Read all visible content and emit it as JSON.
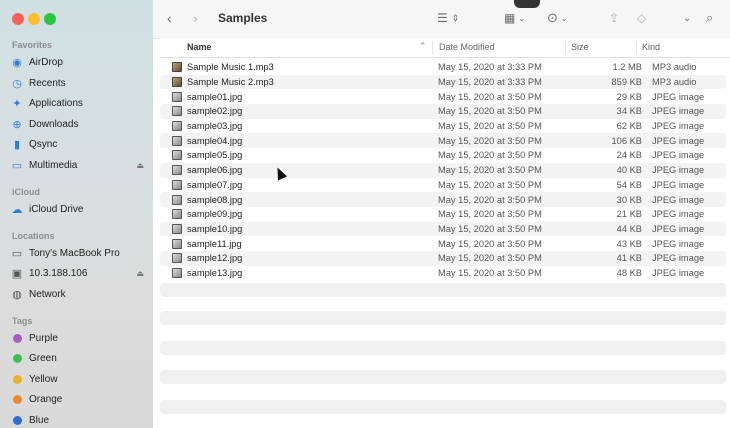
{
  "window": {
    "title": "Samples"
  },
  "sidebar": {
    "favorites_label": "Favorites",
    "favorites": [
      {
        "label": "AirDrop",
        "icon": "airdrop-icon"
      },
      {
        "label": "Recents",
        "icon": "clock-icon"
      },
      {
        "label": "Applications",
        "icon": "applications-icon"
      },
      {
        "label": "Downloads",
        "icon": "download-icon"
      },
      {
        "label": "Qsync",
        "icon": "document-icon"
      },
      {
        "label": "Multimedia",
        "icon": "folder-icon"
      }
    ],
    "icloud_label": "iCloud",
    "icloud": [
      {
        "label": "iCloud Drive",
        "icon": "cloud-icon"
      }
    ],
    "locations_label": "Locations",
    "locations": [
      {
        "label": "Tony's MacBook Pro",
        "icon": "laptop-icon"
      },
      {
        "label": "10.3.188.106",
        "icon": "monitor-icon"
      },
      {
        "label": "Network",
        "icon": "globe-icon"
      }
    ],
    "tags_label": "Tags",
    "tags": [
      {
        "label": "Purple",
        "color": "#a55ec9"
      },
      {
        "label": "Green",
        "color": "#3fbf4f"
      },
      {
        "label": "Yellow",
        "color": "#e6b422"
      },
      {
        "label": "Orange",
        "color": "#f0892c"
      },
      {
        "label": "Blue",
        "color": "#2a6dd8"
      }
    ]
  },
  "table": {
    "headers": {
      "name": "Name",
      "date": "Date Modified",
      "size": "Size",
      "kind": "Kind"
    },
    "rows": [
      {
        "name": "Sample Music 1.mp3",
        "date": "May 15, 2020 at 3:33 PM",
        "size": "1.2 MB",
        "kind": "MP3 audio",
        "type": "audio"
      },
      {
        "name": "Sample Music 2.mp3",
        "date": "May 15, 2020 at 3:33 PM",
        "size": "859 KB",
        "kind": "MP3 audio",
        "type": "audio"
      },
      {
        "name": "sample01.jpg",
        "date": "May 15, 2020 at 3:50 PM",
        "size": "29 KB",
        "kind": "JPEG image",
        "type": "image"
      },
      {
        "name": "sample02.jpg",
        "date": "May 15, 2020 at 3:50 PM",
        "size": "34 KB",
        "kind": "JPEG image",
        "type": "image"
      },
      {
        "name": "sample03.jpg",
        "date": "May 15, 2020 at 3:50 PM",
        "size": "62 KB",
        "kind": "JPEG image",
        "type": "image"
      },
      {
        "name": "sample04.jpg",
        "date": "May 15, 2020 at 3:50 PM",
        "size": "106 KB",
        "kind": "JPEG image",
        "type": "image"
      },
      {
        "name": "sample05.jpg",
        "date": "May 15, 2020 at 3:50 PM",
        "size": "24 KB",
        "kind": "JPEG image",
        "type": "image"
      },
      {
        "name": "sample06.jpg",
        "date": "May 15, 2020 at 3:50 PM",
        "size": "40 KB",
        "kind": "JPEG image",
        "type": "image"
      },
      {
        "name": "sample07.jpg",
        "date": "May 15, 2020 at 3:50 PM",
        "size": "54 KB",
        "kind": "JPEG image",
        "type": "image"
      },
      {
        "name": "sample08.jpg",
        "date": "May 15, 2020 at 3:50 PM",
        "size": "30 KB",
        "kind": "JPEG image",
        "type": "image"
      },
      {
        "name": "sample09.jpg",
        "date": "May 15, 2020 at 3:50 PM",
        "size": "21 KB",
        "kind": "JPEG image",
        "type": "image"
      },
      {
        "name": "sample10.jpg",
        "date": "May 15, 2020 at 3:50 PM",
        "size": "44 KB",
        "kind": "JPEG image",
        "type": "image"
      },
      {
        "name": "sample11.jpg",
        "date": "May 15, 2020 at 3:50 PM",
        "size": "43 KB",
        "kind": "JPEG image",
        "type": "image"
      },
      {
        "name": "sample12.jpg",
        "date": "May 15, 2020 at 3:50 PM",
        "size": "41 KB",
        "kind": "JPEG image",
        "type": "image"
      },
      {
        "name": "sample13.jpg",
        "date": "May 15, 2020 at 3:50 PM",
        "size": "48 KB",
        "kind": "JPEG image",
        "type": "image"
      }
    ]
  }
}
